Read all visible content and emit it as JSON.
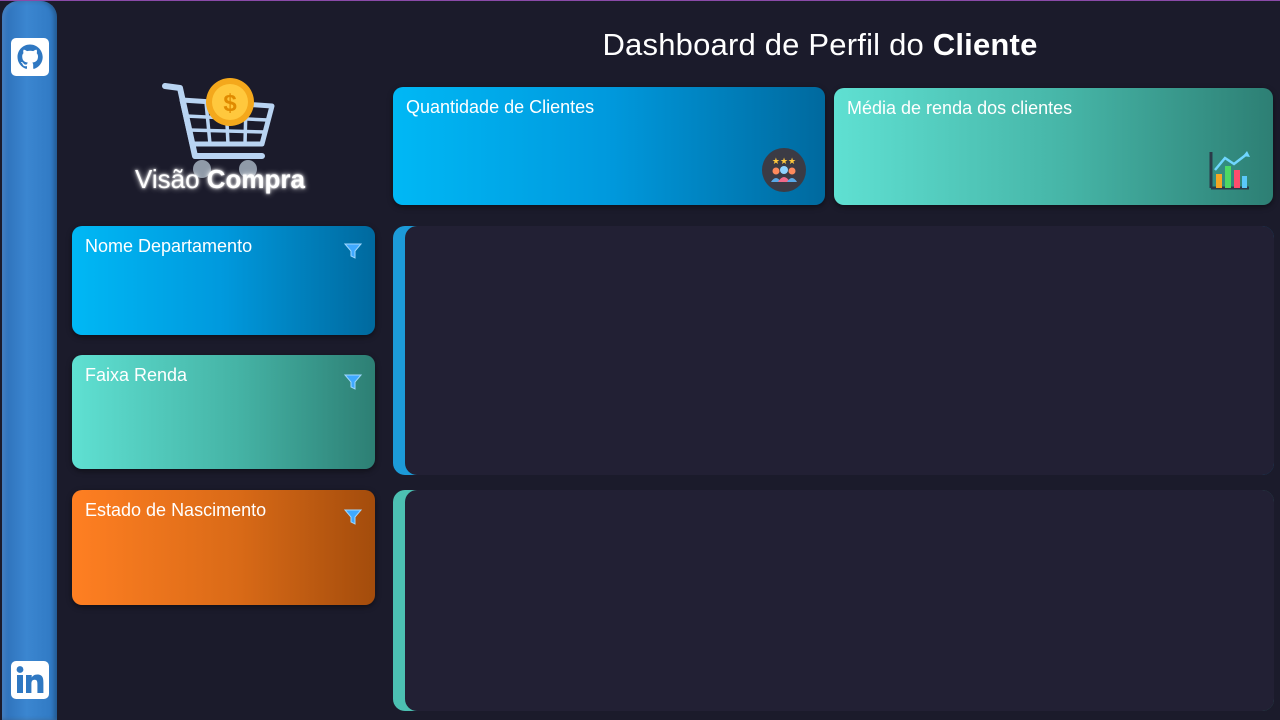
{
  "header": {
    "title_regular": "Dashboard de Perfil do ",
    "title_bold": "Cliente"
  },
  "logo": {
    "text_regular": "Visão ",
    "text_bold": "Compra"
  },
  "kpis": [
    {
      "label": "Quantidade de Clientes",
      "icon": "customers-rating-icon"
    },
    {
      "label": "Média de renda dos clientes",
      "icon": "bar-chart-trend-icon"
    }
  ],
  "filters": [
    {
      "label": "Nome Departamento",
      "icon": "filter-icon"
    },
    {
      "label": "Faixa Renda",
      "icon": "filter-icon"
    },
    {
      "label": "Estado de Nascimento",
      "icon": "filter-icon"
    }
  ],
  "sidebar": {
    "icons": [
      "github-icon",
      "linkedin-icon"
    ]
  },
  "colors": {
    "background": "#1b1b2b",
    "panel": "#222034",
    "blue": "#00b8f5",
    "teal": "#5fe0d2",
    "orange": "#ff7f22",
    "sidebar": "#3b86d0"
  }
}
